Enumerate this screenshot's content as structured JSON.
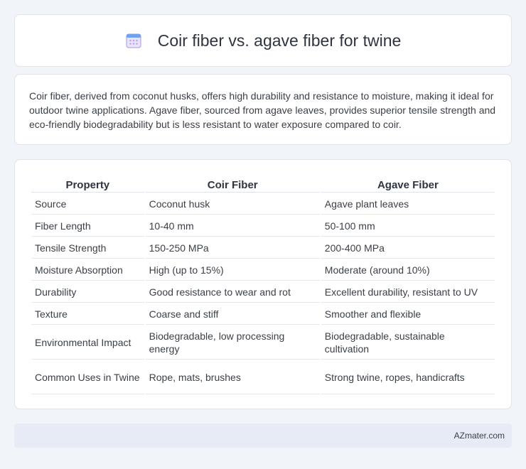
{
  "header": {
    "title": "Coir fiber vs. agave fiber for twine",
    "icon": "calendar-icon"
  },
  "intro": {
    "text": "Coir fiber, derived from coconut husks, offers high durability and resistance to moisture, making it ideal for outdoor twine applications. Agave fiber, sourced from agave leaves, provides superior tensile strength and eco-friendly biodegradability but is less resistant to water exposure compared to coir."
  },
  "table": {
    "headers": [
      "Property",
      "Coir Fiber",
      "Agave Fiber"
    ],
    "rows": [
      [
        "Source",
        "Coconut husk",
        "Agave plant leaves"
      ],
      [
        "Fiber Length",
        "10-40 mm",
        "50-100 mm"
      ],
      [
        "Tensile Strength",
        "150-250 MPa",
        "200-400 MPa"
      ],
      [
        "Moisture Absorption",
        "High (up to 15%)",
        "Moderate (around 10%)"
      ],
      [
        "Durability",
        "Good resistance to wear and rot",
        "Excellent durability, resistant to UV"
      ],
      [
        "Texture",
        "Coarse and stiff",
        "Smoother and flexible"
      ],
      [
        "Environmental Impact",
        "Biodegradable, low processing energy",
        "Biodegradable, sustainable cultivation"
      ],
      [
        "Common Uses in Twine",
        "Rope, mats, brushes",
        "Strong twine, ropes, handicrafts"
      ]
    ]
  },
  "footer": {
    "text": "AZmater.com"
  }
}
